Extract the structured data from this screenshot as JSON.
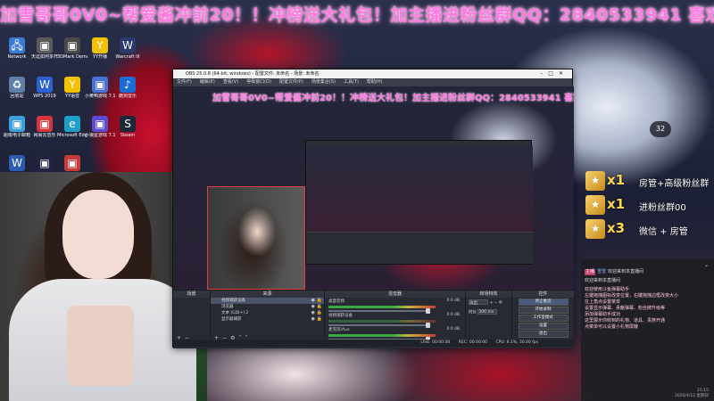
{
  "stream_banner": "加雪哥哥0V0~帮爱酱冲前20！！冲榜送大礼包！加主播进粉丝群QQ：2840533941 喜欢主",
  "desktop_icons": [
    {
      "label": "Network",
      "icon": "network-icon",
      "color": "#3b7bd8"
    },
    {
      "label": "天涯如何多开",
      "icon": "app-icon",
      "color": "#5a5a5a"
    },
    {
      "label": "3DMark Demo",
      "icon": "app-icon",
      "color": "#4a4a4a"
    },
    {
      "label": "YY开播",
      "icon": "yy-icon",
      "color": "#f2c200"
    },
    {
      "label": "Warcraft III",
      "icon": "game-icon",
      "color": "#2a3a6a"
    },
    {
      "label": "回收站",
      "icon": "recycle-bin-icon",
      "color": "#5f7fa8"
    },
    {
      "label": "WPS 2019",
      "icon": "wps-icon",
      "color": "#2a62d6"
    },
    {
      "label": "YY语音",
      "icon": "yy-icon",
      "color": "#f2c200"
    },
    {
      "label": "小黄鸭游戏 7.1",
      "icon": "app-icon",
      "color": "#4a6fd6"
    },
    {
      "label": "酷狗音乐",
      "icon": "music-icon",
      "color": "#1a6bd6"
    },
    {
      "label": "超级电子邮箱",
      "icon": "app-icon",
      "color": "#3aa0e0"
    },
    {
      "label": "网易云音乐",
      "icon": "app-icon",
      "color": "#d6333a"
    },
    {
      "label": "Microsoft Edge",
      "icon": "edge-icon",
      "color": "#1fa0c8"
    },
    {
      "label": "小狼星游戏 7.1",
      "icon": "app-icon",
      "color": "#5a4ad6"
    },
    {
      "label": "Steam",
      "icon": "steam-icon",
      "color": "#1b2838"
    },
    {
      "label": "Word",
      "icon": "word-icon",
      "color": "#2b5cb0"
    },
    {
      "label": "K",
      "icon": "app-icon",
      "color": "#222244"
    },
    {
      "label": "360",
      "icon": "app-icon",
      "color": "#c83a3a"
    }
  ],
  "obs": {
    "title": "OBS 25.0.8 (64-bit, windows) - 配置文件: 未命名 - 场景: 未命名",
    "menu": [
      "文件(F)",
      "编辑(E)",
      "查看(V)",
      "停靠窗口(D)",
      "配置文件(P)",
      "场景集合(S)",
      "工具(T)",
      "帮助(H)"
    ],
    "preview_banner": "加雪哥哥0V0~帮爱酱冲前20！！冲榜送大礼包！加主播进粉丝群QQ：2840533941 喜欢主",
    "docks": {
      "scenes_title": "场景",
      "sources_title": "来源",
      "mixer_title": "混音器",
      "transitions_title": "转场特效",
      "controls_title": "控件"
    },
    "sources": [
      {
        "name": "视频捕获设备",
        "selected": true
      },
      {
        "name": "浏览器",
        "selected": false
      },
      {
        "name": "文本 (GDI+) 2",
        "selected": false
      },
      {
        "name": "显示器捕获",
        "selected": false
      }
    ],
    "mixer": [
      {
        "name": "桌面音频",
        "db": "0.0 dB",
        "active": true
      },
      {
        "name": "视频捕获设备",
        "db": "0.0 dB",
        "active": false
      },
      {
        "name": "麦克风/Aux",
        "db": "0.0 dB",
        "active": true
      }
    ],
    "transitions": {
      "type": "淡出",
      "duration_label": "时长",
      "duration_value": "300 ms"
    },
    "controls": [
      "开始录制",
      "工作室模式",
      "设置",
      "退出"
    ],
    "controls_active": "停止推流",
    "status": {
      "live": "LIVE: 00:00:00",
      "rec": "REC: 00:00:00",
      "cpu": "CPU: 6.1%, 30.00 fps"
    }
  },
  "gifts": [
    {
      "mult": "x1",
      "text": "房管+高级粉丝群"
    },
    {
      "mult": "x1",
      "text": "进粉丝群00"
    },
    {
      "mult": "x3",
      "text": "微信 + 房管"
    }
  ],
  "timer_badge": "32",
  "chat": {
    "messages": [
      {
        "tag": "主播",
        "name": "雪雪",
        "text": "欢迎来到本直播间"
      },
      {
        "tag": "",
        "name": "",
        "text": "欢迎来到本直播间"
      }
    ],
    "notices": [
      "欢迎使用斗鱼弹幕助手",
      "左键拖拽图标改变位置，右键拖拽边框改变大小",
      "在上角点设置菜单",
      "设置显示弹幕、贡献弹幕、粉丝牌升级等",
      "添加弹幕助手成功",
      "这里展示你收到的礼物、道具、贵族开通",
      "点菜单可以设置小礼物屏蔽"
    ],
    "time": "21:15",
    "date": "2020/4/12 星期日"
  }
}
